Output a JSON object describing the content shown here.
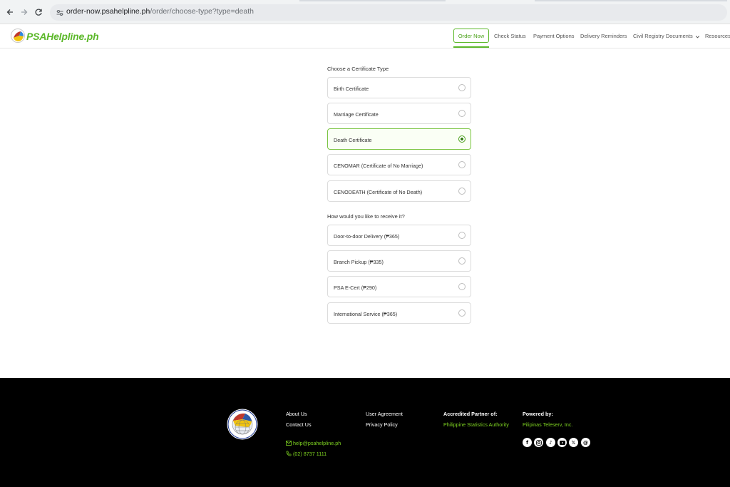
{
  "browser": {
    "url_host": "order-now.psahelpline.ph",
    "url_path": "/order/choose-type?type=death",
    "back_icon": "arrow-left-icon",
    "forward_icon": "arrow-right-icon",
    "reload_icon": "reload-icon",
    "site_info_icon": "tune-icon"
  },
  "header": {
    "logo_text": "PSAHelpline.ph",
    "nav": {
      "order_now": "Order Now",
      "check_status": "Check Status",
      "payment_options": "Payment Options",
      "delivery_reminders": "Delivery Reminders",
      "civil_registry": "Civil Registry Documents",
      "civil_registry_icon": "chevron-down-icon",
      "resources": "Resources"
    },
    "accent_color": "#5cb82a"
  },
  "form": {
    "certificate_heading": "Choose a Certificate Type",
    "certificate_types": [
      {
        "label": "Birth Certificate",
        "selected": false
      },
      {
        "label": "Marriage Certificate",
        "selected": false
      },
      {
        "label": "Death Certificate",
        "selected": true
      },
      {
        "label": "CENOMAR (Certificate of No Marriage)",
        "selected": false
      },
      {
        "label": "CENODEATH (Certificate of No Death)",
        "selected": false
      }
    ],
    "delivery_heading": "How would you like to receive it?",
    "delivery_options": [
      {
        "label": "Door-to-door Delivery (₱365)",
        "selected": false
      },
      {
        "label": "Branch Pickup (₱335)",
        "selected": false
      },
      {
        "label": "PSA E-Cert (₱290)",
        "selected": false
      },
      {
        "label": "International Service (₱365)",
        "selected": false
      }
    ]
  },
  "footer": {
    "about_us": "About Us",
    "contact_us": "Contact Us",
    "email": "help@psahelpline.ph",
    "phone": "(02) 8737 1111",
    "user_agreement": "User Agreement",
    "privacy_policy": "Privacy Policy",
    "partner_heading": "Accredited Partner of:",
    "partner_name": "Philippine Statistics Authority",
    "powered_heading": "Powered by:",
    "powered_name": "Pilipinas Teleserv, Inc.",
    "social_icons": [
      "facebook-icon",
      "instagram-icon",
      "tiktok-icon",
      "youtube-icon",
      "x-icon",
      "threads-icon"
    ]
  }
}
